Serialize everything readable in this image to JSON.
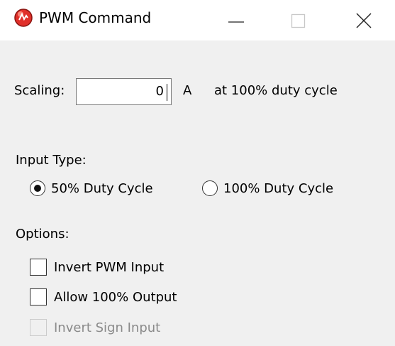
{
  "window": {
    "title": "PWM Command",
    "app_icon": "pwm-app-icon",
    "controls": {
      "minimize": "minimize-icon",
      "maximize": "maximize-icon",
      "close": "close-icon"
    }
  },
  "scaling": {
    "label": "Scaling:",
    "value": "0",
    "unit": "A",
    "note": "at 100% duty cycle"
  },
  "input_type": {
    "label": "Input Type:",
    "options": [
      {
        "label": "50% Duty Cycle",
        "selected": true
      },
      {
        "label": "100% Duty Cycle",
        "selected": false
      }
    ]
  },
  "options": {
    "label": "Options:",
    "items": [
      {
        "label": "Invert PWM Input",
        "checked": false,
        "enabled": true
      },
      {
        "label": "Allow 100% Output",
        "checked": false,
        "enabled": true
      },
      {
        "label": "Invert Sign Input",
        "checked": false,
        "enabled": false
      }
    ]
  },
  "colors": {
    "titlebar": "#ffffff",
    "client_background": "#f0f0f0",
    "icon_red": "#e0302a",
    "disabled_text": "#8a8a8a"
  }
}
